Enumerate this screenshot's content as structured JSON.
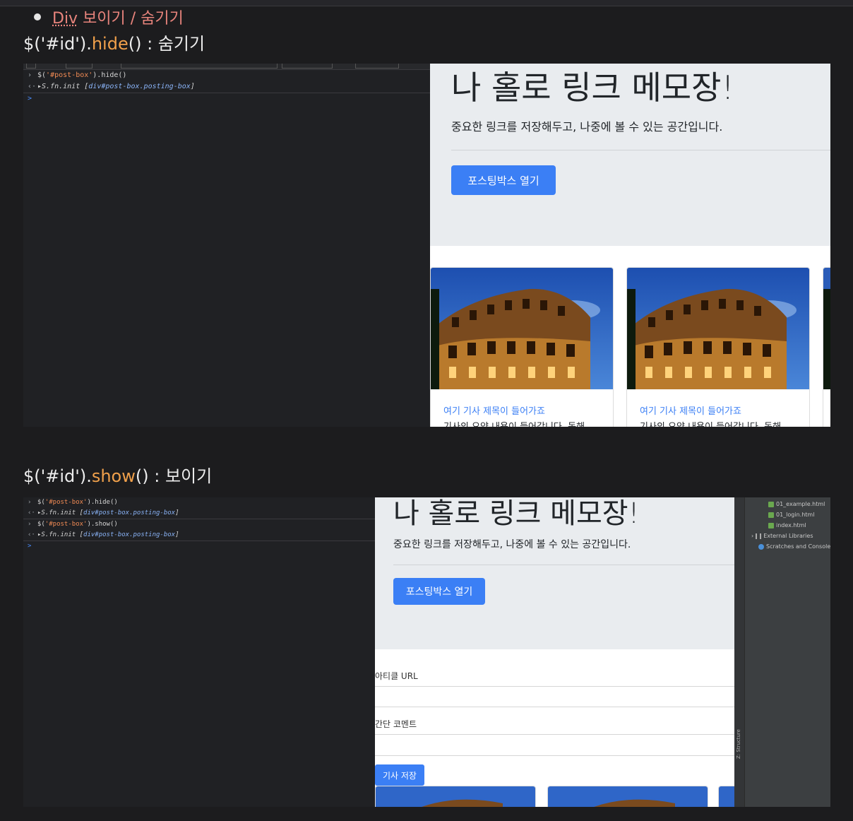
{
  "bullet": {
    "keyword": "Div",
    "rest": " 보이기 / 숨기기"
  },
  "section1": {
    "heading_prefix": "$('#id').",
    "heading_method": "hide",
    "heading_suffix": "() : 숨기기",
    "console": {
      "cmd_prefix": "$(",
      "cmd_arg": "'#post-box'",
      "cmd_suffix": ").hide()",
      "result_obj": "S.fn.init",
      "result_sel": "div#post-box.posting-box",
      "prompt": ">"
    },
    "page": {
      "title": "나 홀로 링크 메모장!",
      "subtitle": "중요한 링크를 저장해두고, 나중에 볼 수 있는 공간입니다.",
      "button": "포스팅박스 열기",
      "cards": [
        {
          "title": "여기 기사 제목이 들어가죠",
          "text": "기사의 요약 내용이 들어갑니다. 동해"
        },
        {
          "title": "여기 기사 제목이 들어가죠",
          "text": "기사의 요약 내용이 들어갑니다. 동해"
        }
      ]
    }
  },
  "section2": {
    "heading_prefix": "$('#id').",
    "heading_method": "show",
    "heading_suffix": "() : 보이기",
    "console": {
      "cmd1_prefix": "$(",
      "cmd1_arg": "'#post-box'",
      "cmd1_suffix": ").hide()",
      "cmd2_prefix": "$(",
      "cmd2_arg": "'#post-box'",
      "cmd2_suffix": ").show()",
      "result_obj": "S.fn.init",
      "result_sel": "div#post-box.posting-box",
      "prompt": ">"
    },
    "page": {
      "title": "나 홀로 링크 메모장!",
      "subtitle": "중요한 링크를 저장해두고, 나중에 볼 수 있는 공간입니다.",
      "button": "포스팅박스 열기",
      "url_label": "아티클 URL",
      "comment_label": "간단 코멘트",
      "save_button": "기사 저장"
    },
    "ide": {
      "files": [
        "01_example.html",
        "01_login.html",
        "index.html"
      ],
      "external": "External Libraries",
      "scratches": "Scratches and Consoles",
      "structure": "Z: Structure"
    }
  },
  "colors": {
    "accent": "#f0a04b",
    "link": "#3b7ff5",
    "bullet": "#e8847c"
  }
}
